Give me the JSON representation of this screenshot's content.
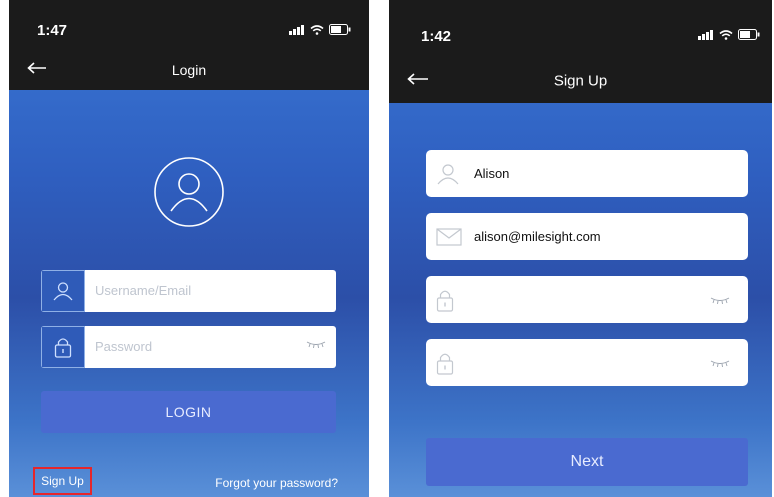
{
  "login_screen": {
    "status_time": "1:47",
    "title": "Login",
    "username_placeholder": "Username/Email",
    "password_placeholder": "Password",
    "login_button": "LOGIN",
    "signup_link": "Sign Up",
    "forgot_link": "Forgot your password?"
  },
  "signup_screen": {
    "status_time": "1:42",
    "title": "Sign Up",
    "name_value": "Alison",
    "email_value": "alison@milesight.com",
    "password_value": "",
    "confirm_value": "",
    "next_button": "Next"
  },
  "icons": {
    "back": "arrow-left-icon",
    "avatar": "user-circle-icon",
    "user": "user-icon",
    "lock": "lock-icon",
    "mail": "mail-icon",
    "eye_closed": "eye-closed-icon",
    "signal": "signal-icon",
    "wifi": "wifi-icon",
    "battery": "battery-icon"
  },
  "colors": {
    "header": "#1b1b1b",
    "button": "#4a6ad0",
    "highlight_box": "#e5262b"
  }
}
